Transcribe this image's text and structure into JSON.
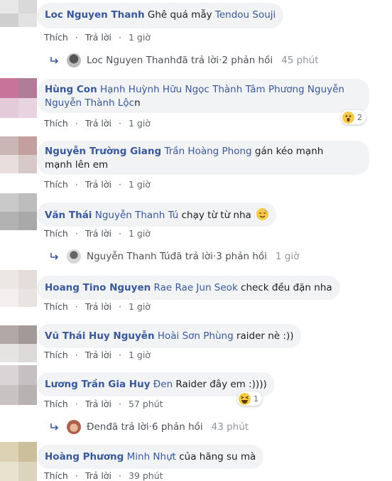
{
  "actions": {
    "like": "Thích",
    "reply": "Trả lời",
    "dot": "·"
  },
  "comments": [
    {
      "author": "Loc Nguyen Thanh",
      "pre": " Ghê quá mẫy ",
      "tag": "Tendou Souji",
      "post": "",
      "time": "1 giờ"
    },
    {
      "author": "Hùng Con",
      "pre": " ",
      "tag": "Hạnh Huỳnh Hữu Ngọc Thành Tâm Phương Nguyễn Nguyễn Thành Lộc",
      "post": "n",
      "time": "1 giờ",
      "reaction_count": "2"
    },
    {
      "author": "Nguyễn Trường Giang",
      "pre": " ",
      "tag": "Trần Hoàng Phong",
      "post": " gán kéo mạnh mạnh lên em",
      "time": "1 giờ"
    },
    {
      "author": "Văn Thái",
      "pre": " ",
      "tag": "Nguyễn Thanh Tú",
      "post": " chạy từ từ nha ",
      "time": "1 giờ"
    },
    {
      "author": "Hoang Tino Nguyen",
      "pre": " ",
      "tag": "Rae Rae Jun Seok",
      "post": " check đều đặn nha",
      "time": "1 giờ"
    },
    {
      "author": "Vũ Thái Huy Nguyễn",
      "pre": " ",
      "tag": "Hoài Sơn Phùng",
      "post": " raider nè :))",
      "time": "1 giờ"
    },
    {
      "author": "Lương Trần Gia Huy",
      "pre": " ",
      "tag": "Đen",
      "post": " Raider đây em :))))",
      "time": "57 phút",
      "reaction_count": "1"
    },
    {
      "author": "Hoàng Phương",
      "pre": " ",
      "tag": "Minh Nhựt",
      "post": " của hãng su mà",
      "time": "39 phút"
    }
  ],
  "replies": [
    {
      "name": "Loc Nguyen Thanh",
      "text": " đã trả lời",
      "sep": " · ",
      "count": "2 phản hồi",
      "time": "45 phút"
    },
    {
      "name": "Nguyễn Thanh Tú",
      "text": " đã trả lời",
      "sep": " · ",
      "count": "3 phản hồi",
      "time": "1 giờ"
    },
    {
      "name": "Đen",
      "text": " đã trả lời",
      "sep": " · ",
      "count": "6 phản hồi",
      "time": "43 phút"
    }
  ],
  "colors": {
    "link": "#385898",
    "bubble": "#f2f3f5",
    "meta": "#606770"
  }
}
